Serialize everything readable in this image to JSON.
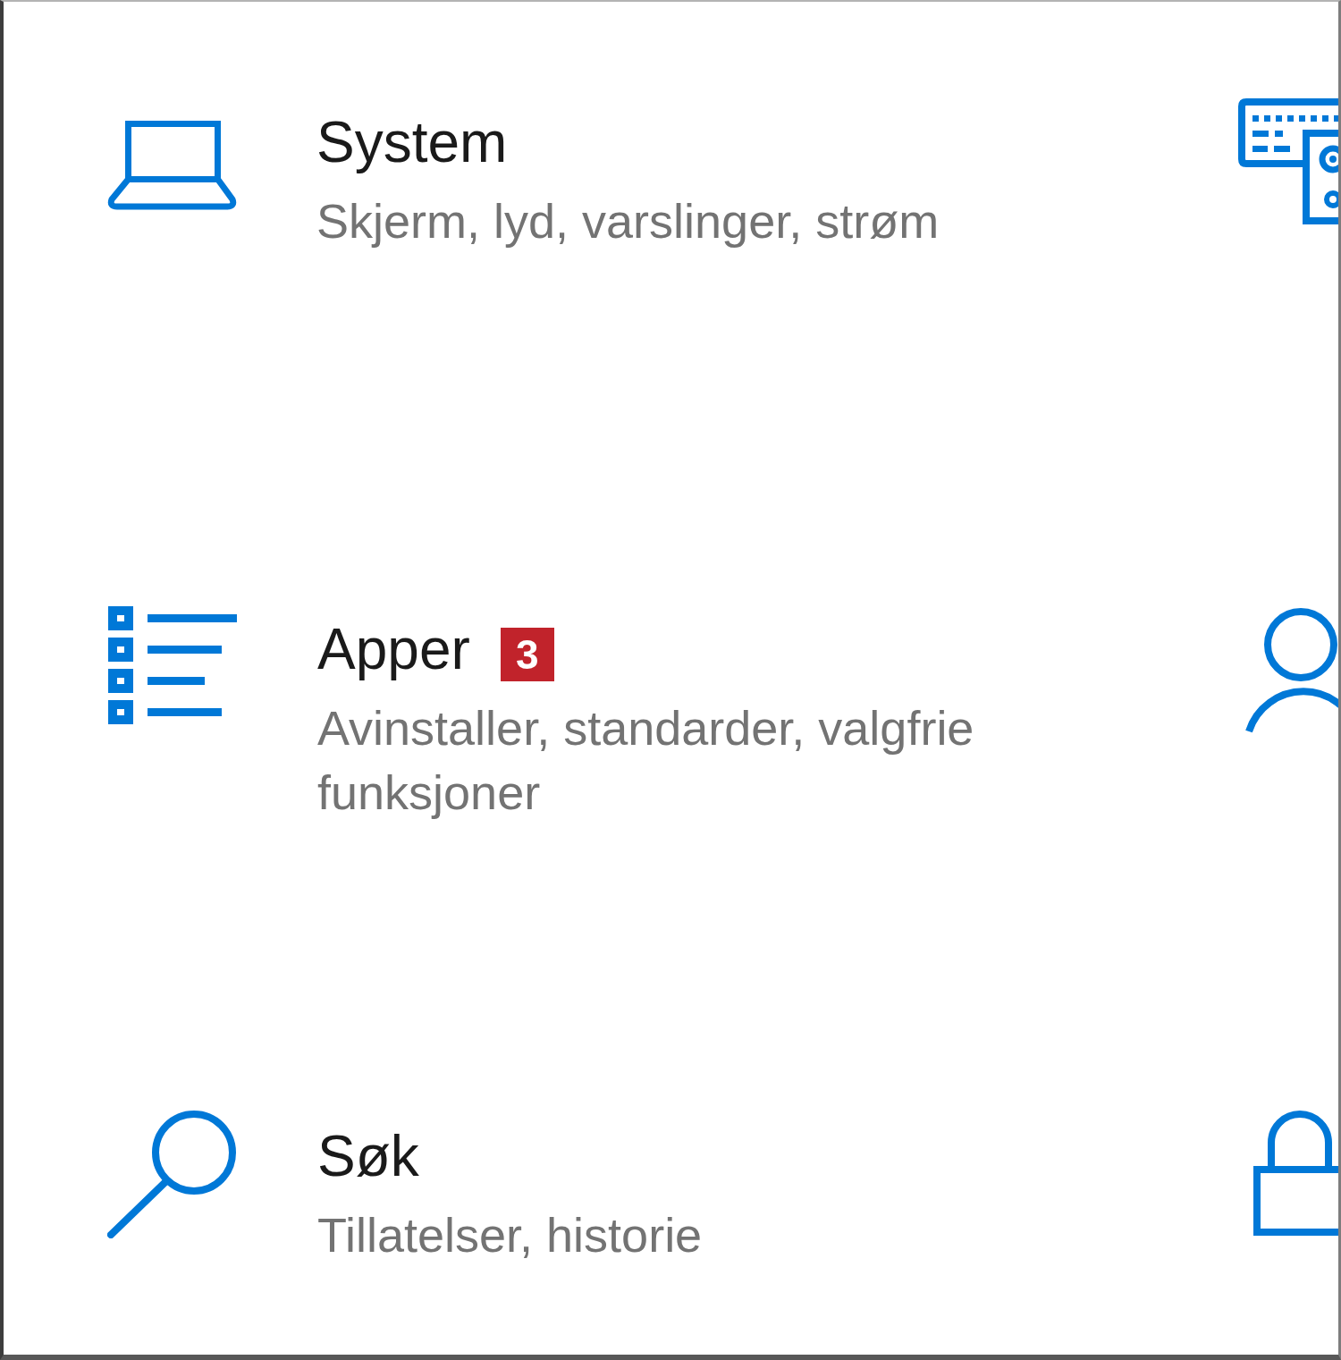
{
  "tiles": [
    {
      "kind": "laptop",
      "title": "System",
      "description": "Skjerm, lyd, varslinger, strøm"
    },
    {
      "kind": "keyboard"
    },
    {
      "kind": "list",
      "title": "Apper",
      "badge": "3",
      "description": "Avinstaller, standarder, valgfrie funksjoner"
    },
    {
      "kind": "person"
    },
    {
      "kind": "search",
      "title": "Søk",
      "description": "Tillatelser, historie"
    },
    {
      "kind": "lock"
    }
  ]
}
